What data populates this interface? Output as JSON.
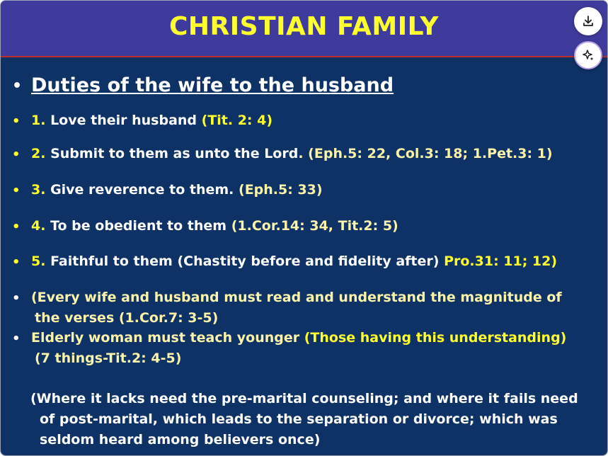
{
  "header": {
    "title": "CHRISTIAN FAMILY"
  },
  "actions": {
    "download_icon": "download-icon",
    "ai_icon": "sparkle-icon"
  },
  "heading": "Duties of the wife to the husband",
  "items": [
    {
      "num": "1.",
      "text": " Love their husband ",
      "ref": "(Tit. 2: 4)"
    },
    {
      "num": "2.",
      "text": " Submit to them as unto the Lord",
      "ref": ". (Eph.5: 22, Col.3: 18; 1.Pet.3: 1)"
    },
    {
      "num": "3.",
      "text": " Give reverence to them. ",
      "ref": "(Eph.5: 33)"
    },
    {
      "num": "4.",
      "text": " To be obedient to them ",
      "ref": "(1.Cor.14: 34, Tit.2: 5)"
    },
    {
      "num": "5.",
      "text": " Faithful to them (Chastity before and fidelity after) ",
      "ref": "Pro.31: 11; 12)"
    }
  ],
  "note1": {
    "line1": "(Every wife and husband must read and understand the magnitude of",
    "line2": "the verses (1.Cor.7: 3-5)"
  },
  "note2": {
    "text": "Elderly woman must  teach younger ",
    "highlight": "(Those having this understanding)",
    "line2": "(7 things-Tit.2: 4-5)"
  },
  "closing": {
    "line1": "(Where it lacks need the pre-marital counseling; and where it fails need",
    "line2": "of post-marital, which leads to the separation or divorce;  which was",
    "line3": "seldom heard among believers  once)"
  },
  "colors": {
    "background": "#0e3265",
    "header": "#3f3b9c",
    "title": "#ffff2d",
    "text": "#ffffff",
    "accent": "#ffff2d"
  }
}
